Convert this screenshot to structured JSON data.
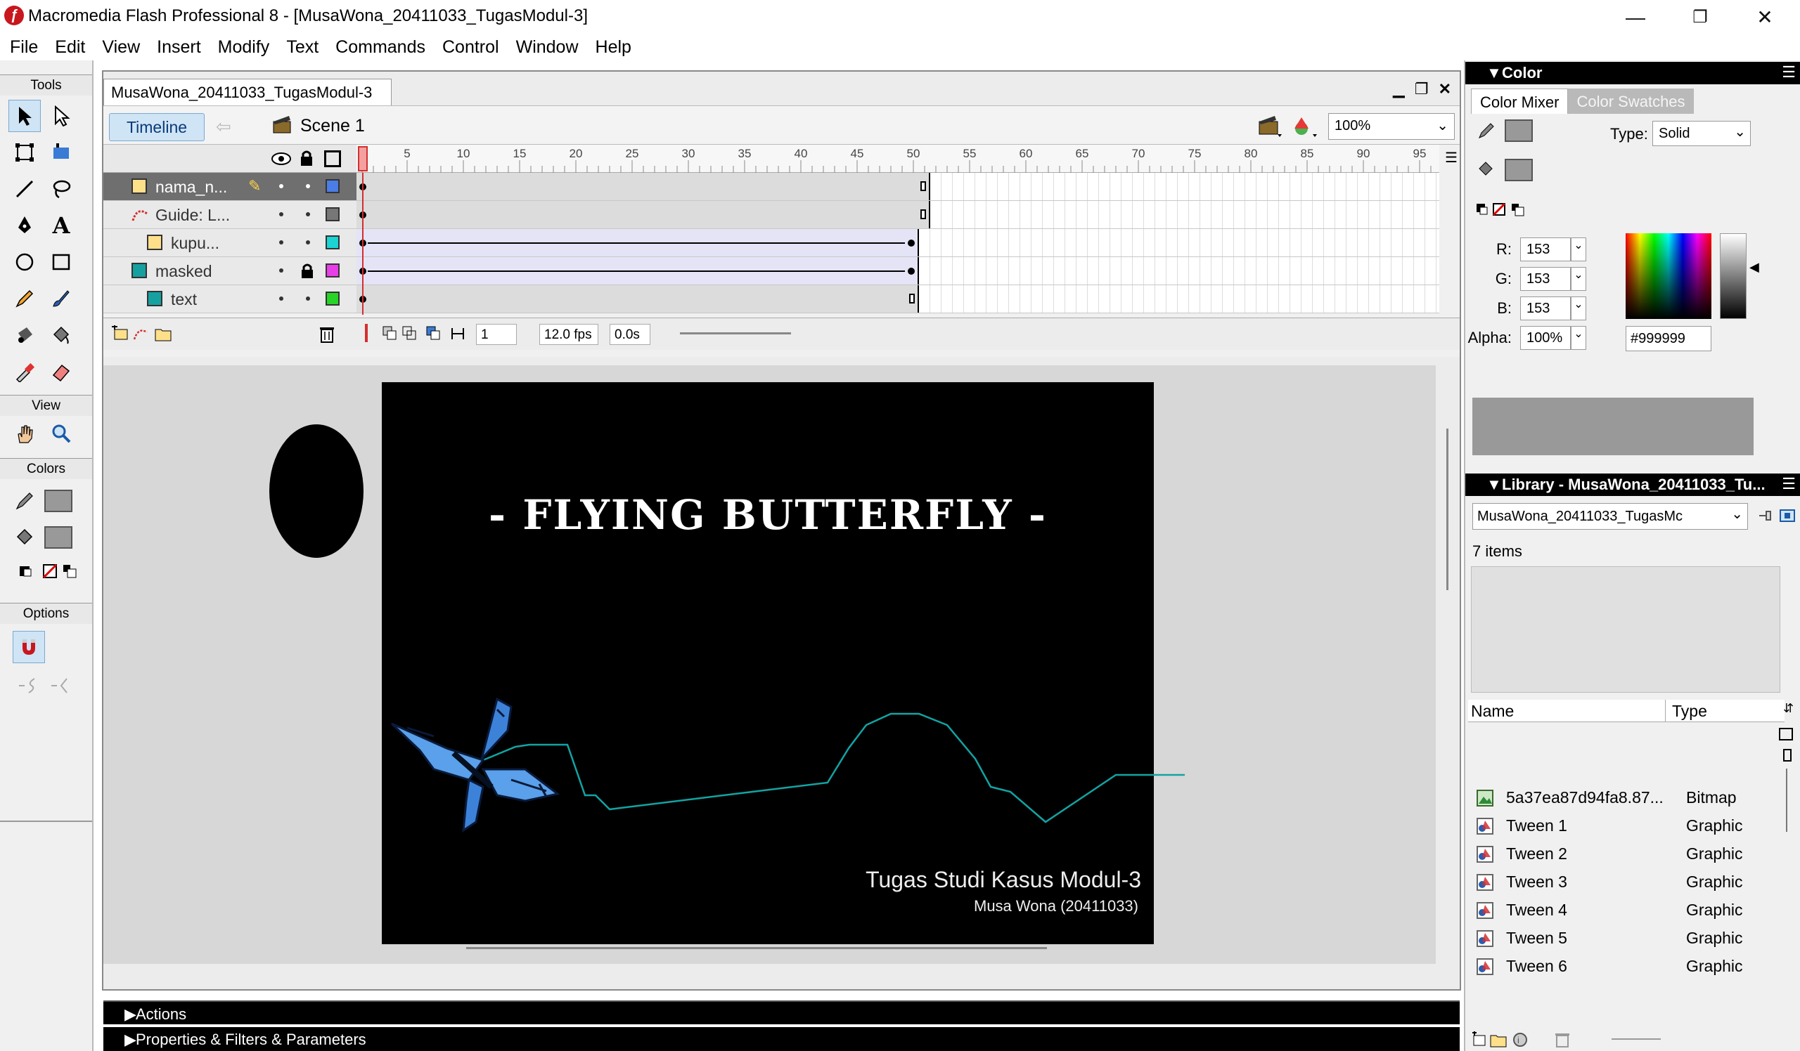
{
  "window": {
    "title": "Macromedia Flash Professional 8 - [MusaWona_20411033_TugasModul-3]",
    "minimize": "—",
    "restore": "❐",
    "close": "✕"
  },
  "menu": [
    "File",
    "Edit",
    "View",
    "Insert",
    "Modify",
    "Text",
    "Commands",
    "Control",
    "Window",
    "Help"
  ],
  "tools": {
    "title": "Tools",
    "view_label": "View",
    "colors_label": "Colors",
    "options_label": "Options"
  },
  "document": {
    "tab": "MusaWona_20411033_TugasModul-3",
    "timeline_button": "Timeline",
    "scene": "Scene 1",
    "zoom": "100%"
  },
  "timeline": {
    "ruler": [
      "5",
      "10",
      "15",
      "20",
      "25",
      "30",
      "35",
      "40",
      "45",
      "50",
      "55",
      "60",
      "65",
      "70",
      "75",
      "80",
      "85",
      "90",
      "95"
    ],
    "layers": [
      {
        "name": "nama_n...",
        "selected": true
      },
      {
        "name": "Guide: L...",
        "selected": false
      },
      {
        "name": "kupu...",
        "selected": false
      },
      {
        "name": "masked",
        "selected": false
      },
      {
        "name": "text",
        "selected": false
      }
    ],
    "current_frame": "1",
    "fps": "12.0 fps",
    "elapsed": "0.0s"
  },
  "stage": {
    "title": "- FLYING BUTTERFLY -",
    "subtitle1": "Tugas Studi Kasus Modul-3",
    "subtitle2": "Musa Wona (20411033)"
  },
  "bottom_panels": {
    "actions": "Actions",
    "properties": "Properties & Filters & Parameters"
  },
  "color_panel": {
    "title": "Color",
    "tab_mixer": "Color Mixer",
    "tab_swatches": "Color Swatches",
    "type_label": "Type:",
    "type_value": "Solid",
    "r_label": "R:",
    "r": "153",
    "g_label": "G:",
    "g": "153",
    "b_label": "B:",
    "b": "153",
    "alpha_label": "Alpha:",
    "alpha": "100%",
    "hex": "#999999",
    "swatch_color": "#999999"
  },
  "library": {
    "title": "Library - MusaWona_20411033_Tu...",
    "doc_select": "MusaWona_20411033_TugasMc",
    "count": "7 items",
    "col_name": "Name",
    "col_type": "Type",
    "items": [
      {
        "name": "5a37ea87d94fa8.87...",
        "type": "Bitmap"
      },
      {
        "name": "Tween 1",
        "type": "Graphic"
      },
      {
        "name": "Tween 2",
        "type": "Graphic"
      },
      {
        "name": "Tween 3",
        "type": "Graphic"
      },
      {
        "name": "Tween 4",
        "type": "Graphic"
      },
      {
        "name": "Tween 5",
        "type": "Graphic"
      },
      {
        "name": "Tween 6",
        "type": "Graphic"
      }
    ]
  }
}
